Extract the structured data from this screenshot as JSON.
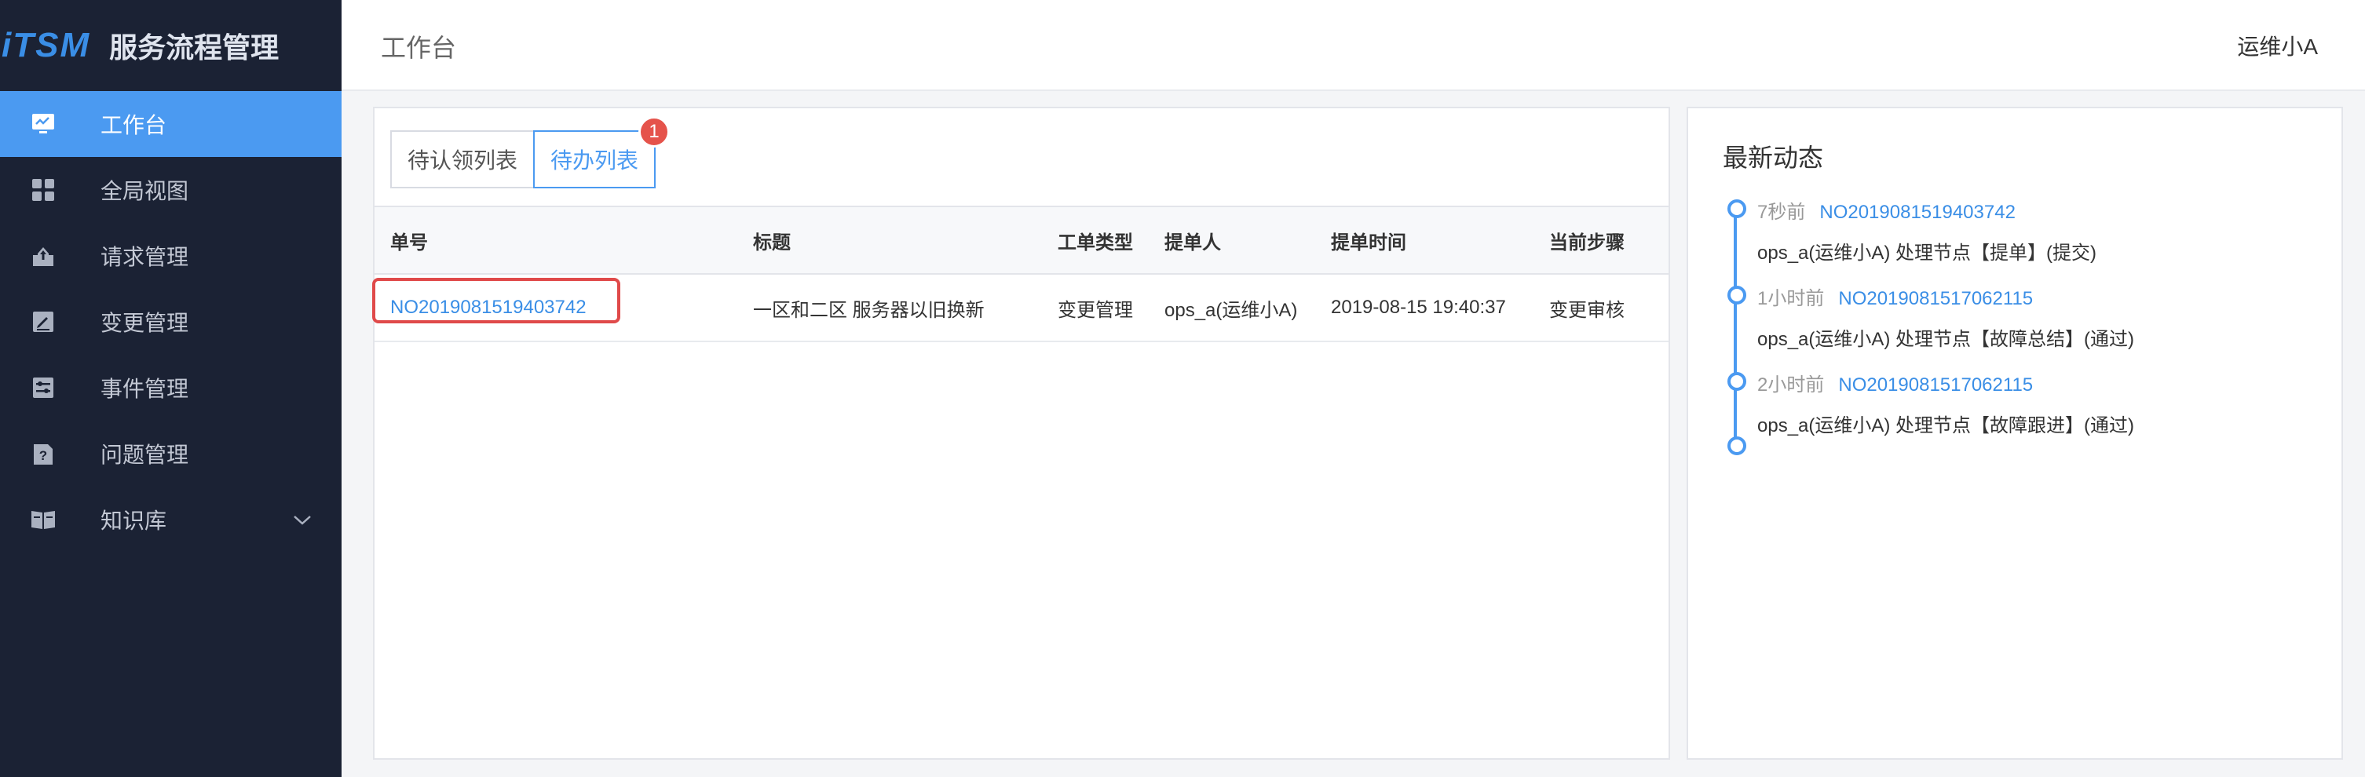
{
  "brand": {
    "logo": "iTSM",
    "name": "服务流程管理"
  },
  "sidebar": {
    "items": [
      {
        "label": "工作台",
        "icon": "monitor-icon",
        "active": true
      },
      {
        "label": "全局视图",
        "icon": "grid-icon"
      },
      {
        "label": "请求管理",
        "icon": "upload-icon"
      },
      {
        "label": "变更管理",
        "icon": "edit-icon"
      },
      {
        "label": "事件管理",
        "icon": "sliders-icon"
      },
      {
        "label": "问题管理",
        "icon": "question-doc-icon"
      },
      {
        "label": "知识库",
        "icon": "book-icon",
        "expandable": true
      }
    ]
  },
  "header": {
    "title": "工作台",
    "user": "运维小A"
  },
  "tabs": [
    {
      "label": "待认领列表",
      "active": false
    },
    {
      "label": "待办列表",
      "active": true,
      "badge": "1"
    }
  ],
  "table": {
    "columns": [
      "单号",
      "标题",
      "工单类型",
      "提单人",
      "提单时间",
      "当前步骤"
    ],
    "rows": [
      [
        "NO2019081519403742",
        "一区和二区 服务器以旧换新",
        "变更管理",
        "ops_a(运维小A)",
        "2019-08-15 19:40:37",
        "变更审核"
      ]
    ]
  },
  "activity": {
    "title": "最新动态",
    "items": [
      {
        "time": "7秒前",
        "ticket": "NO2019081519403742",
        "desc": "ops_a(运维小A) 处理节点【提单】(提交)"
      },
      {
        "time": "1小时前",
        "ticket": "NO2019081517062115",
        "desc": "ops_a(运维小A) 处理节点【故障总结】(通过)"
      },
      {
        "time": "2小时前",
        "ticket": "NO2019081517062115",
        "desc": "ops_a(运维小A) 处理节点【故障跟进】(通过)"
      }
    ]
  },
  "colors": {
    "sidebar_bg": "#1b2234",
    "accent": "#4b9af1",
    "link": "#3a8ee6",
    "badge": "#e5534b",
    "highlight": "#e04a4a"
  }
}
